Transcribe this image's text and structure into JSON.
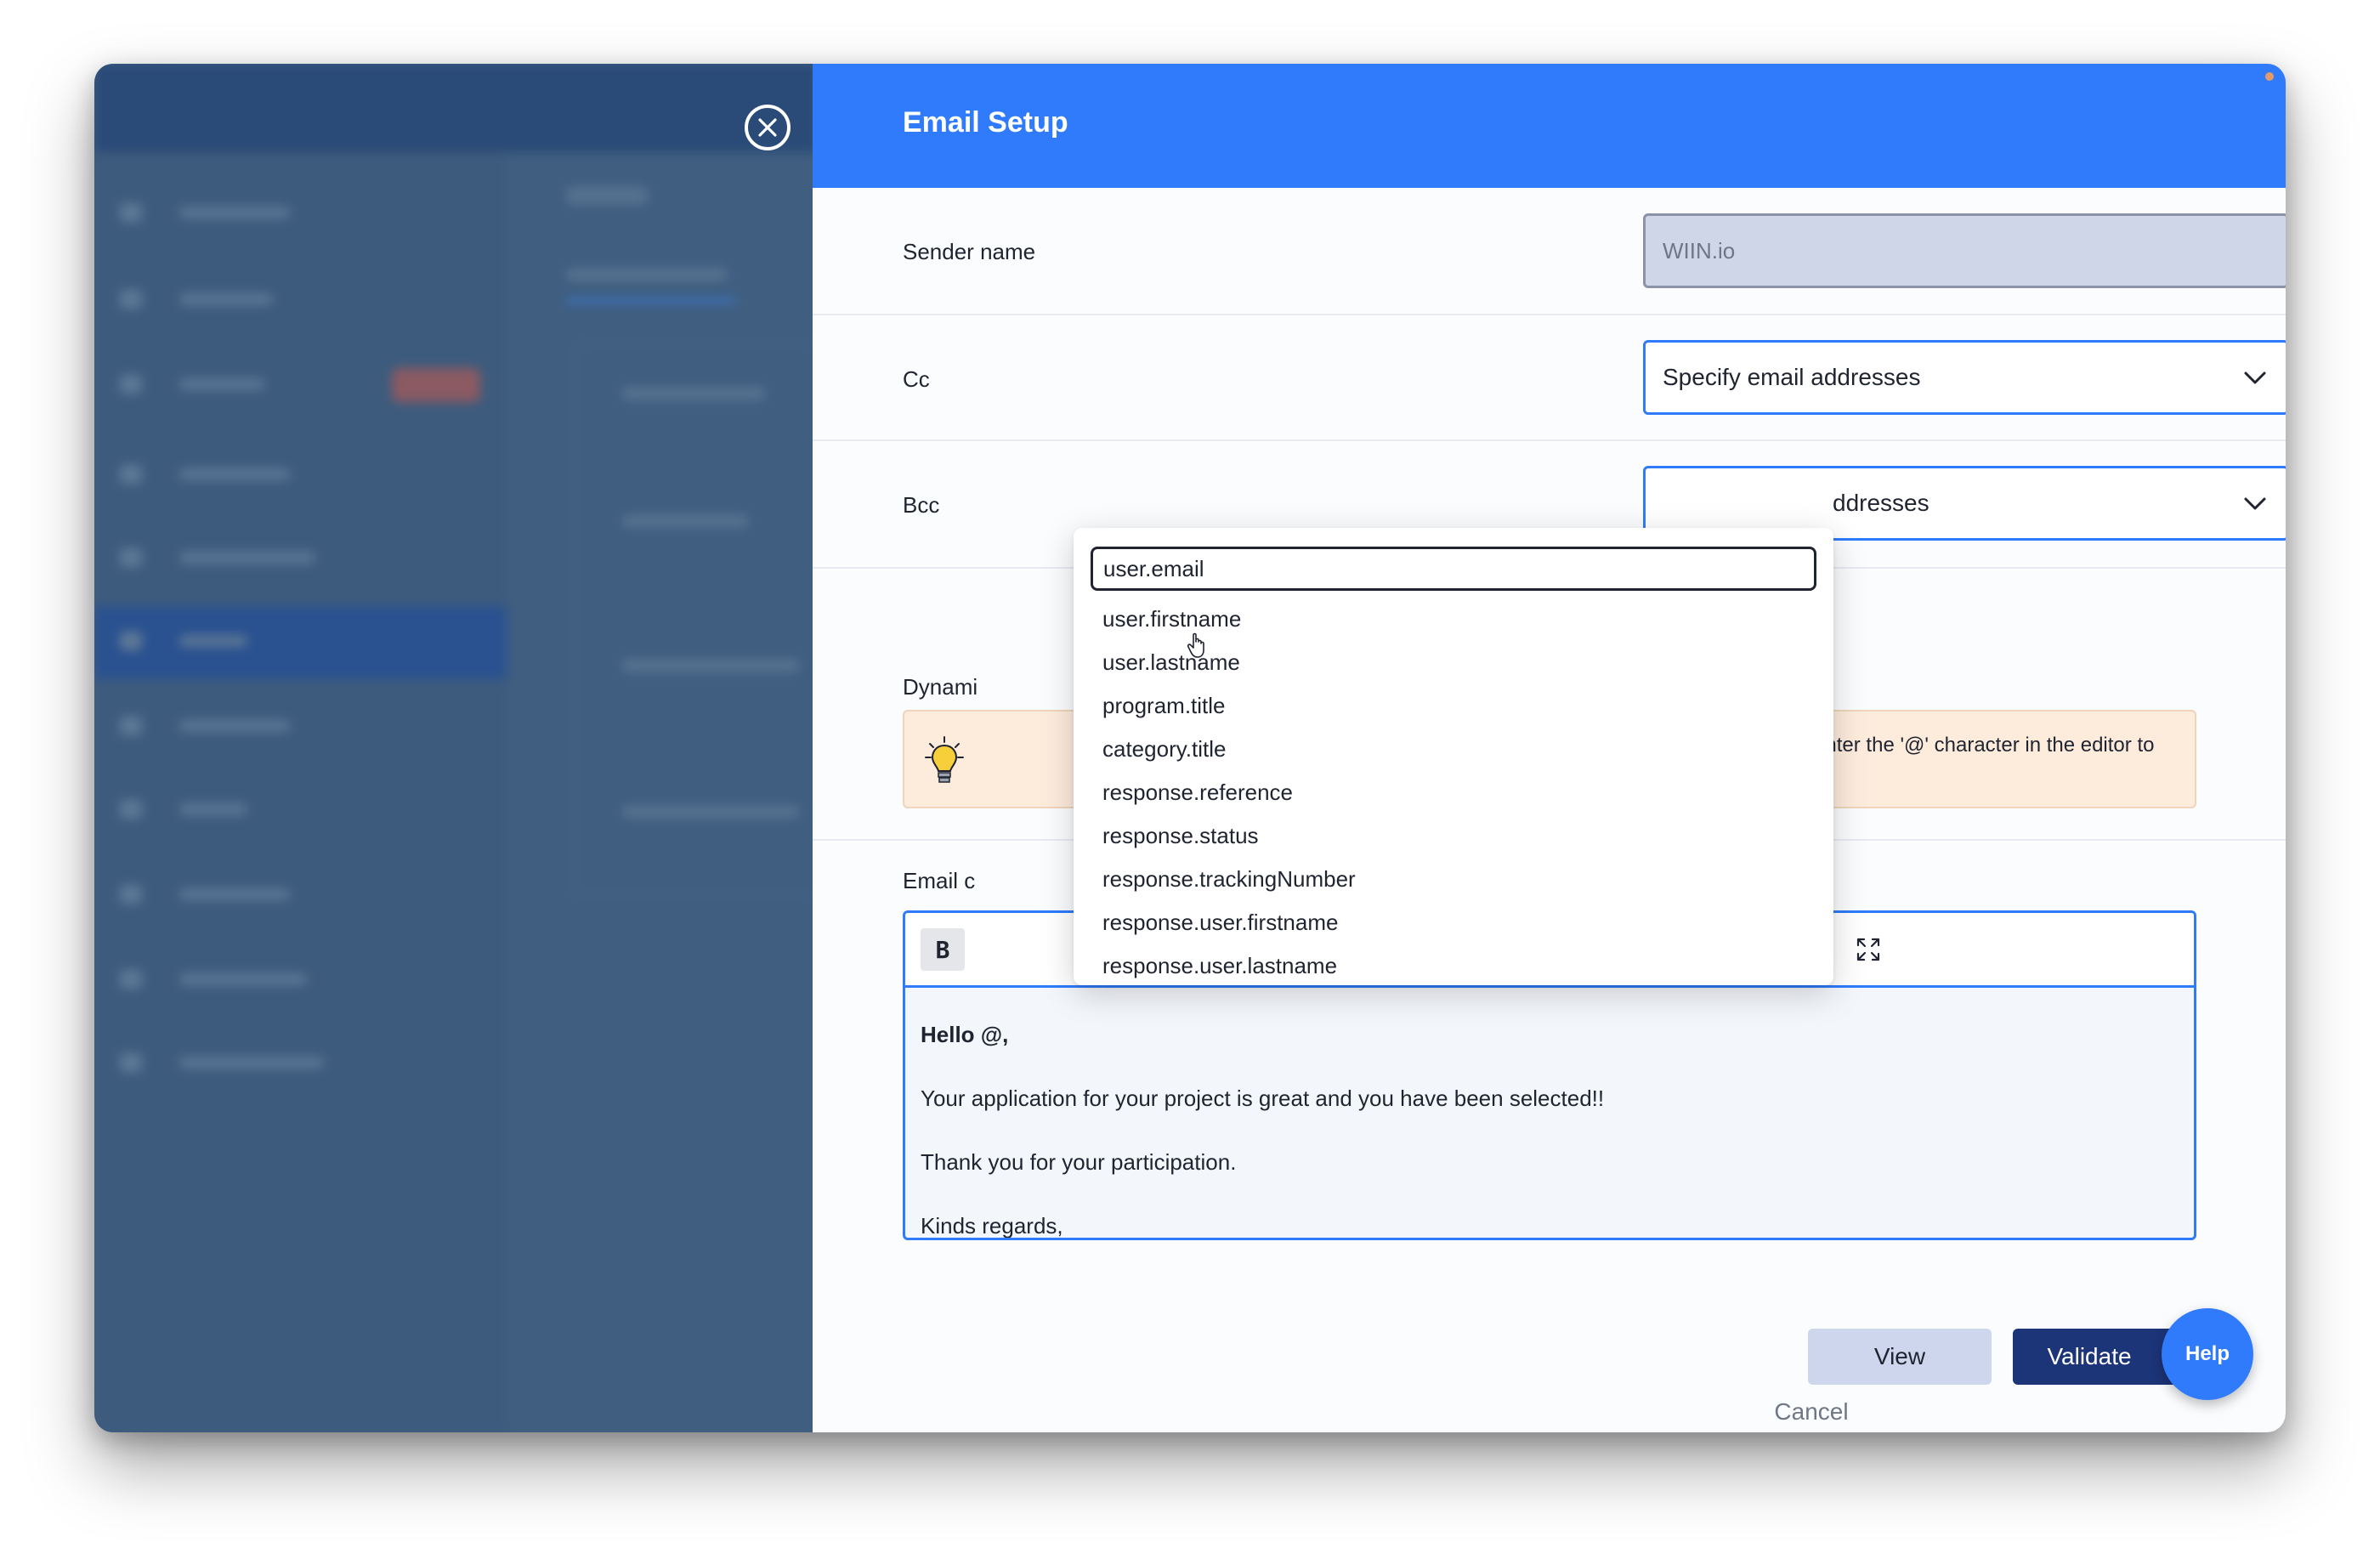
{
  "panel": {
    "title": "Email Setup"
  },
  "form": {
    "sender_label": "Sender name",
    "sender_value": "WIIN.io",
    "cc_label": "Cc",
    "cc_value": "Specify email addresses",
    "bcc_label": "Bcc",
    "bcc_value_visible": "ddresses",
    "dynamic_label": "Dynami",
    "hint_text": "Please enter the '@' character in the editor to",
    "email_label": "Email c"
  },
  "dropdown": {
    "search_value": "user.email",
    "items": [
      "user.firstname",
      "user.lastname",
      "program.title",
      "category.title",
      "response.reference",
      "response.status",
      "response.trackingNumber",
      "response.user.firstname",
      "response.user.lastname"
    ]
  },
  "editor": {
    "bold_label": "B",
    "lines": [
      "Hello @,",
      "Your application for your project is great and you have been selected!!",
      "Thank you for your participation.",
      "Kinds regards,"
    ]
  },
  "footer": {
    "cancel_label": "Cancel",
    "view_label": "View",
    "validate_label": "Validate",
    "help_label": "Help"
  },
  "colors": {
    "primary": "#2f7bfb",
    "validate": "#1c3478",
    "hint_bg": "#fdebdc"
  },
  "icons": {
    "close": "close-icon",
    "chevron": "chevron-down-icon",
    "bulb": "lightbulb-icon",
    "undo": "undo-icon",
    "redo": "redo-icon",
    "fullscreen": "fullscreen-icon"
  }
}
